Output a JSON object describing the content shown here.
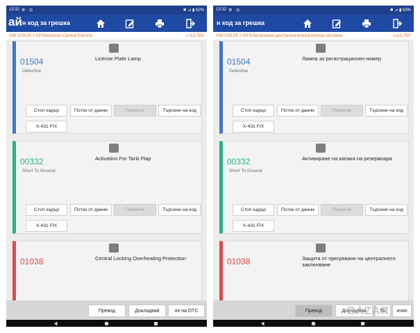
{
  "colors": {
    "header": "#1f4aa3",
    "statusbar": "#1f3f8c",
    "blue": "#3d78c6",
    "green": "#2bb08a",
    "red": "#dd4a4a",
    "breadcrumb": "#d8752a"
  },
  "icons": [
    "home-icon",
    "report-edit-icon",
    "print-icon",
    "exit-icon",
    "battery-icon",
    "back-icon",
    "home-circle-icon",
    "recents-icon"
  ],
  "panels": [
    {
      "status": {
        "time": "13:32",
        "battery": "62%"
      },
      "title": "н код за грешка",
      "title_overlay": "ай",
      "breadcrumb": "VW V29.05 > 09 Electronic Central Electric",
      "voltage": "13,78V",
      "cards": [
        {
          "code": "01504",
          "status": "Defective",
          "desc": "License Plate Lamp"
        },
        {
          "code": "00332",
          "status": "Short To Ground",
          "desc": "Activation For Tank Flap"
        },
        {
          "code": "01038",
          "status": "",
          "desc": "Central Locking Overheating Protection"
        }
      ],
      "buttons": {
        "freeze": "Стоп кадър",
        "stream": "Поток от данни",
        "help": "Помогне",
        "search": "Търсене на код",
        "fix": "X-431 FIX"
      },
      "bottom": [
        "Превод",
        "Докладвай",
        "не на DTC"
      ]
    },
    {
      "status": {
        "time": "13:32",
        "battery": "63%"
      },
      "title": "н код за грешка",
      "breadcrumb": "VW V29.05 > 09 Електронна централна електрическа система",
      "voltage": "13,78V",
      "cards": [
        {
          "code": "01504",
          "status": "Defective",
          "desc": "Лампа за регистрационен номер"
        },
        {
          "code": "00332",
          "status": "Short To Ground",
          "desc": "Активиране на капака на резервоара"
        },
        {
          "code": "01038",
          "status": "",
          "desc": "Защита от прегряване на централното заключване"
        }
      ],
      "buttons": {
        "freeze": "Стоп кадър",
        "stream": "Поток от данни",
        "help": "Помогне",
        "search": "Търсене на код",
        "fix": "X-431 FIX"
      },
      "bottom": [
        "Превод",
        "Докладвай",
        "ТС",
        "ичин"
      ]
    }
  ],
  "watermark": "BAZAR"
}
